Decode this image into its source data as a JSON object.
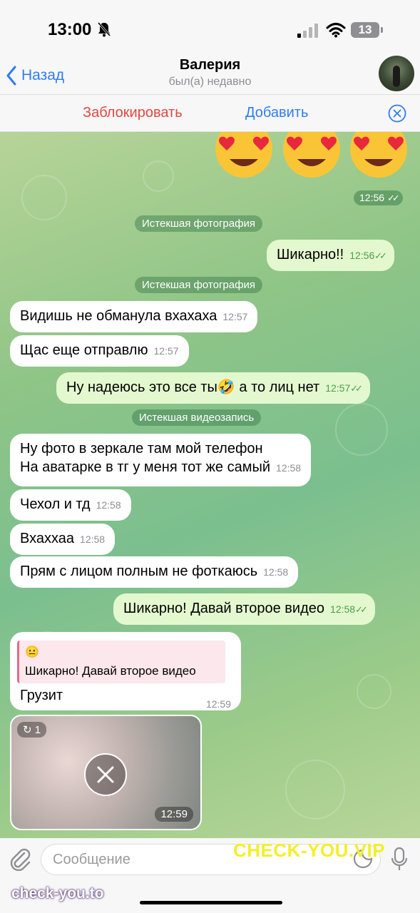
{
  "status_bar": {
    "time": "13:00",
    "battery": "13"
  },
  "nav": {
    "back_label": "Назад",
    "name": "Валерия",
    "status": "был(а) недавно"
  },
  "actions": {
    "block_label": "Заблокировать",
    "add_label": "Добавить"
  },
  "chat": {
    "emoji_time": "12:56",
    "service_1": "Истекшая фотография",
    "service_2": "Истекшая фотография",
    "service_3": "Истекшая видеозапись",
    "messages": [
      {
        "text": "Шикарно!!",
        "time": "12:56",
        "dir": "out"
      },
      {
        "text": "Видишь не обманула вхахаха",
        "time": "12:57",
        "dir": "in"
      },
      {
        "text": "Щас еще отправлю",
        "time": "12:57",
        "dir": "in"
      },
      {
        "text": "Ну надеюсь это все ты🤣 а то лиц нет",
        "time": "12:57",
        "dir": "out"
      },
      {
        "line1": "Ну фото в зеркале там мой телефон",
        "line2": "На аватарке в тг у меня тот же самый",
        "time": "12:58",
        "dir": "in"
      },
      {
        "text": "Чехол и тд",
        "time": "12:58",
        "dir": "in"
      },
      {
        "text": "Вхаххаа",
        "time": "12:58",
        "dir": "in"
      },
      {
        "text": "Прям с лицом полным не фоткаюсь",
        "time": "12:58",
        "dir": "in"
      },
      {
        "text": "Шикарно! Давай второе видео",
        "time": "12:58",
        "dir": "out"
      },
      {
        "quote": "Шикарно! Давай второе видео",
        "text": "Грузит",
        "time": "12:59",
        "dir": "in"
      }
    ],
    "media": {
      "badge": "1",
      "time": "12:59"
    }
  },
  "input": {
    "placeholder": "Сообщение"
  },
  "watermarks": {
    "yellow": "CHECK-YOU.VIP",
    "white": "check-you.to"
  }
}
